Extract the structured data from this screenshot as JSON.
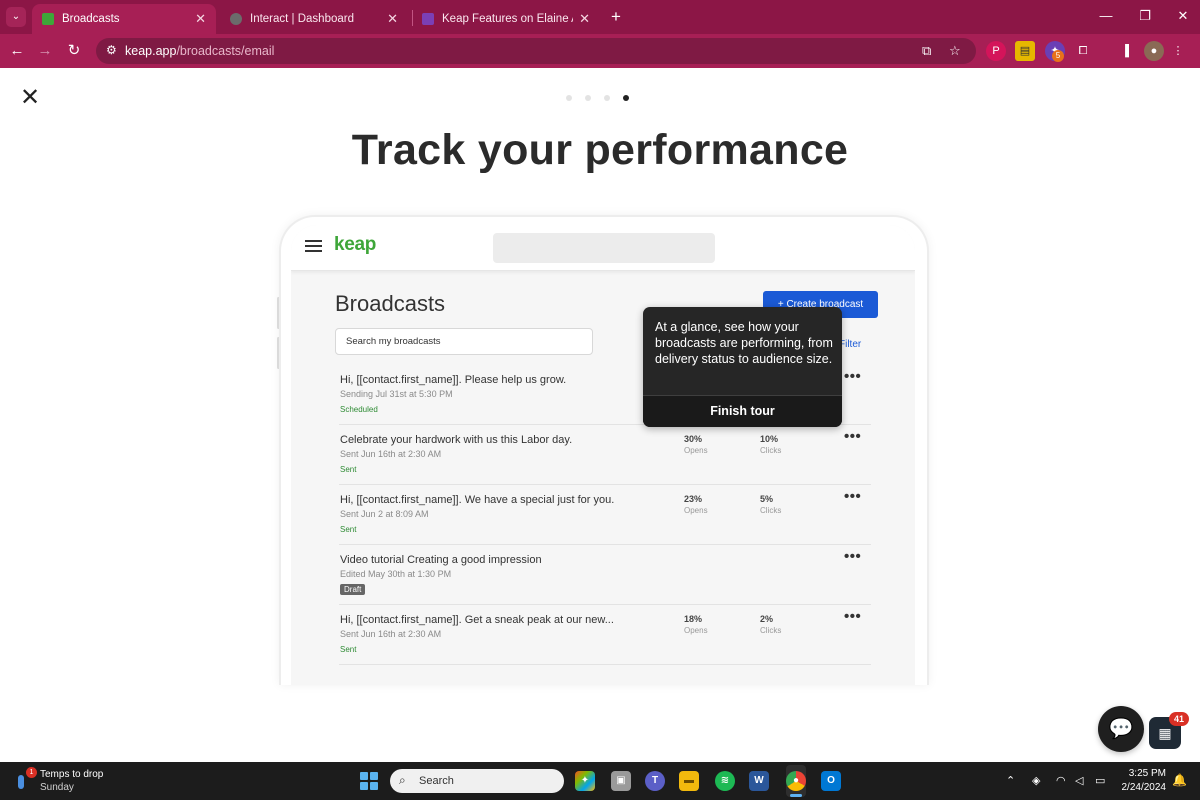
{
  "browser": {
    "tabs": [
      {
        "title": "Broadcasts",
        "active": true,
        "favicon_color": "#3ea639"
      },
      {
        "title": "Interact | Dashboard",
        "active": false,
        "favicon_color": "#6b6b6b"
      },
      {
        "title": "Keap Features on Elaine And Fra",
        "active": false,
        "favicon_color": "#7b3fb5"
      }
    ],
    "url_host": "keap.app",
    "url_path": "/broadcasts/email",
    "extension_badge": "5",
    "theme_color": "#a71f55"
  },
  "tour": {
    "headline": "Track your performance",
    "step_count": 4,
    "active_step": 4,
    "tooltip_text": "At a glance, see how your broadcasts are performing, from delivery status to audience size.",
    "finish_label": "Finish tour"
  },
  "app": {
    "logo": "keap",
    "page_title": "Broadcasts",
    "create_label": "+ Create broadcast",
    "search_placeholder": "Search my broadcasts",
    "filter_label": "Filter",
    "broadcasts": [
      {
        "title": "Hi, [[contact.first_name]]. Please help us grow.",
        "subtitle": "Sending Jul 31st at 5:30 PM",
        "status": "Scheduled",
        "opens": "",
        "opens_label": "",
        "clicks": "",
        "clicks_label": ""
      },
      {
        "title": "Celebrate your hardwork with us this Labor day.",
        "subtitle": "Sent Jun 16th at 2:30 AM",
        "status": "Sent",
        "opens": "30%",
        "opens_label": "Opens",
        "clicks": "10%",
        "clicks_label": "Clicks"
      },
      {
        "title": "Hi, [[contact.first_name]]. We have a special just for you.",
        "subtitle": "Sent Jun 2 at 8:09 AM",
        "status": "Sent",
        "opens": "23%",
        "opens_label": "Opens",
        "clicks": "5%",
        "clicks_label": "Clicks"
      },
      {
        "title": "Video tutorial Creating a good impression",
        "subtitle": "Edited May 30th at 1:30 PM",
        "status": "Draft",
        "opens": "",
        "opens_label": "",
        "clicks": "",
        "clicks_label": ""
      },
      {
        "title": "Hi, [[contact.first_name]]. Get a sneak peak at our new...",
        "subtitle": "Sent Jun 16th at 2:30 AM",
        "status": "Sent",
        "opens": "18%",
        "opens_label": "Opens",
        "clicks": "2%",
        "clicks_label": "Clicks"
      }
    ]
  },
  "widgets": {
    "notification_count": "41"
  },
  "taskbar": {
    "weather_line1": "Temps to drop",
    "weather_line2": "Sunday",
    "weather_badge": "1",
    "search_label": "Search",
    "time": "3:25 PM",
    "date": "2/24/2024"
  }
}
